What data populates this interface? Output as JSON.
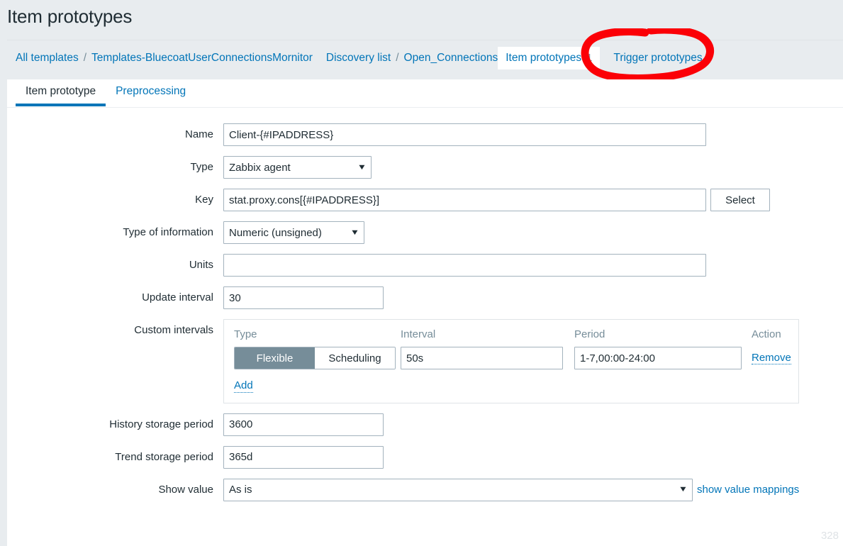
{
  "page": {
    "title": "Item prototypes"
  },
  "breadcrumb": {
    "separator": "/",
    "items": [
      {
        "label": "All templates",
        "type": "link"
      },
      {
        "label": "Templates-BluecoatUserConnectionsMornitor",
        "type": "link"
      },
      {
        "label": "Discovery list",
        "type": "link"
      },
      {
        "label": "Open_Connections",
        "type": "link"
      }
    ],
    "active": {
      "label": "Item prototypes",
      "count": "1"
    },
    "trailing": {
      "label": "Trigger prototypes",
      "type": "link"
    }
  },
  "tabs": [
    {
      "label": "Item prototype",
      "active": true
    },
    {
      "label": "Preprocessing",
      "active": false
    }
  ],
  "form": {
    "name": {
      "label": "Name",
      "value": "Client-{#IPADDRESS}"
    },
    "type": {
      "label": "Type",
      "value": "Zabbix agent"
    },
    "key": {
      "label": "Key",
      "value": "stat.proxy.cons[{#IPADDRESS}]",
      "select_button": "Select"
    },
    "type_of_information": {
      "label": "Type of information",
      "value": "Numeric (unsigned)"
    },
    "units": {
      "label": "Units",
      "value": "",
      "placeholder": ""
    },
    "update_interval": {
      "label": "Update interval",
      "value": "30"
    },
    "custom_intervals": {
      "label": "Custom intervals",
      "headers": [
        "Type",
        "Interval",
        "Period",
        "Action"
      ],
      "rows": [
        {
          "type_flexible": "Flexible",
          "type_scheduling": "Scheduling",
          "type_selected": "Flexible",
          "interval": "50s",
          "period": "1-7,00:00-24:00",
          "action": "Remove"
        }
      ],
      "add_label": "Add"
    },
    "history_storage_period": {
      "label": "History storage period",
      "value": "3600"
    },
    "trend_storage_period": {
      "label": "Trend storage period",
      "value": "365d"
    },
    "show_value": {
      "label": "Show value",
      "value": "As is",
      "mappings_link": "show value mappings"
    }
  },
  "watermark": {
    "text": "328"
  },
  "colors": {
    "accent_blue": "#0275b8",
    "header_bg": "#e8ecef",
    "text_dark": "#1f2c33",
    "muted_gray": "#768d99",
    "border_gray": "#a3b2bd",
    "annotation_red": "#fb0007"
  },
  "icons": {
    "dropdown_caret": "▼"
  }
}
